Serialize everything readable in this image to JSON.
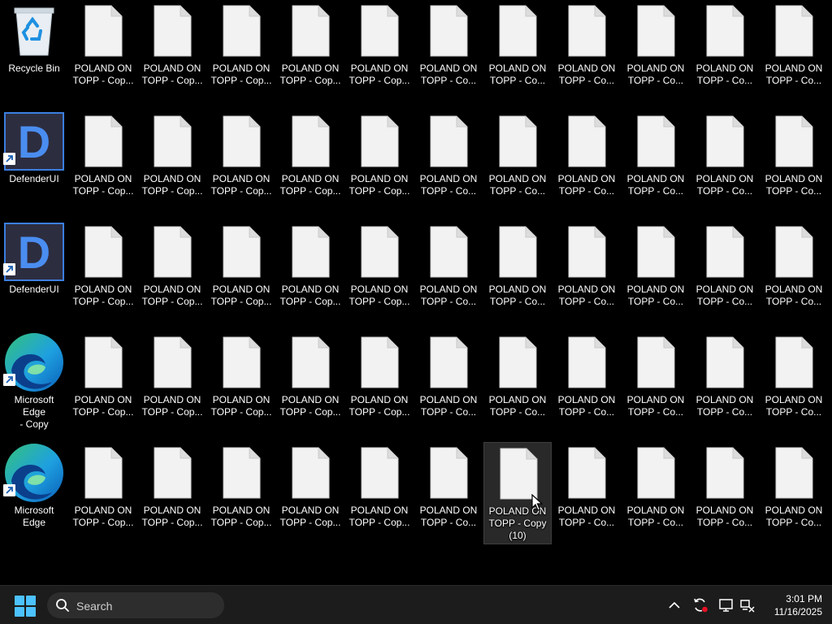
{
  "desktop": {
    "system_icons": [
      {
        "type": "recycle",
        "label": "Recycle Bin"
      },
      {
        "type": "defender",
        "label": "DefenderUI"
      },
      {
        "type": "defender",
        "label": "DefenderUI"
      },
      {
        "type": "edge",
        "label": "Microsoft Edge\n- Copy"
      },
      {
        "type": "edge",
        "label": "Microsoft Edge"
      }
    ],
    "file_grid": [
      [
        "POLAND ON\nTOPP - Cop...",
        "POLAND ON\nTOPP - Cop...",
        "POLAND ON\nTOPP - Cop...",
        "POLAND ON\nTOPP - Cop...",
        "POLAND ON\nTOPP - Cop...",
        "POLAND ON\nTOPP - Co...",
        "POLAND ON\nTOPP - Co...",
        "POLAND ON\nTOPP - Co...",
        "POLAND ON\nTOPP - Co...",
        "POLAND ON\nTOPP - Co...",
        "POLAND ON\nTOPP - Co..."
      ],
      [
        "POLAND ON\nTOPP - Cop...",
        "POLAND ON\nTOPP - Cop...",
        "POLAND ON\nTOPP - Cop...",
        "POLAND ON\nTOPP - Cop...",
        "POLAND ON\nTOPP - Cop...",
        "POLAND ON\nTOPP - Co...",
        "POLAND ON\nTOPP - Co...",
        "POLAND ON\nTOPP - Co...",
        "POLAND ON\nTOPP - Co...",
        "POLAND ON\nTOPP - Co...",
        "POLAND ON\nTOPP - Co..."
      ],
      [
        "POLAND ON\nTOPP - Cop...",
        "POLAND ON\nTOPP - Cop...",
        "POLAND ON\nTOPP - Cop...",
        "POLAND ON\nTOPP - Cop...",
        "POLAND ON\nTOPP - Cop...",
        "POLAND ON\nTOPP - Co...",
        "POLAND ON\nTOPP - Co...",
        "POLAND ON\nTOPP - Co...",
        "POLAND ON\nTOPP - Co...",
        "POLAND ON\nTOPP - Co...",
        "POLAND ON\nTOPP - Co..."
      ],
      [
        "POLAND ON\nTOPP - Cop...",
        "POLAND ON\nTOPP - Cop...",
        "POLAND ON\nTOPP - Cop...",
        "POLAND ON\nTOPP - Cop...",
        "POLAND ON\nTOPP - Cop...",
        "POLAND ON\nTOPP - Co...",
        "POLAND ON\nTOPP - Co...",
        "POLAND ON\nTOPP - Co...",
        "POLAND ON\nTOPP - Co...",
        "POLAND ON\nTOPP - Co...",
        "POLAND ON\nTOPP - Co..."
      ],
      [
        "POLAND ON\nTOPP - Cop...",
        "POLAND ON\nTOPP - Cop...",
        "POLAND ON\nTOPP - Cop...",
        "POLAND ON\nTOPP - Cop...",
        "POLAND ON\nTOPP - Cop...",
        "POLAND ON\nTOPP - Co...",
        "POLAND ON\nTOPP - Copy\n(10)",
        "POLAND ON\nTOPP - Co...",
        "POLAND ON\nTOPP - Co...",
        "POLAND ON\nTOPP - Co...",
        "POLAND ON\nTOPP - Co..."
      ]
    ],
    "selected": {
      "row": 4,
      "col": 6
    }
  },
  "taskbar": {
    "search_placeholder": "Search",
    "clock_time": "3:01 PM",
    "clock_date": "11/16/2025",
    "accent": "#4cc2ff",
    "tray_icons": [
      "chevron-up-icon",
      "sync-alert-icon",
      "display-icon",
      "network-disconnected-icon"
    ]
  }
}
